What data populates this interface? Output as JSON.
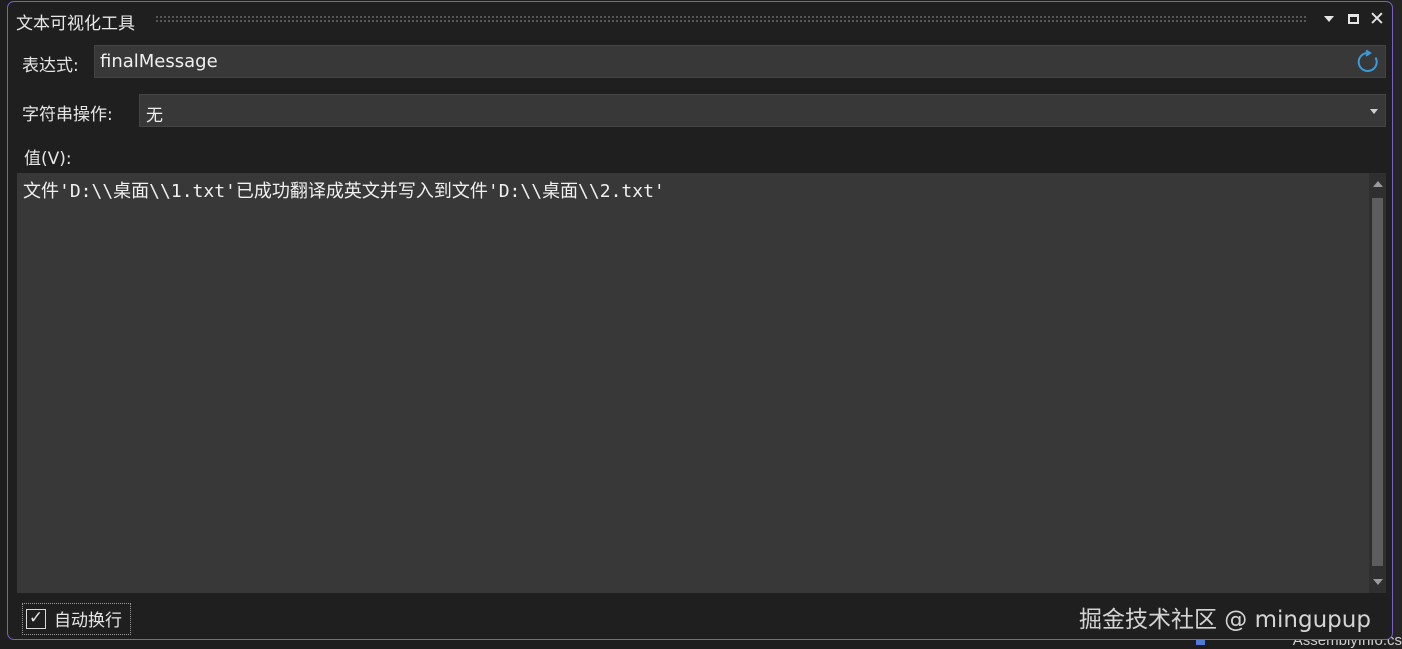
{
  "window": {
    "title": "文本可视化工具"
  },
  "expression": {
    "label": "表达式:",
    "value": "finalMessage"
  },
  "string_ops": {
    "label": "字符串操作:",
    "selected": "无"
  },
  "value_section": {
    "label": "值(V):",
    "text": "文件'D:\\\\桌面\\\\1.txt'已成功翻译成英文并写入到文件'D:\\\\桌面\\\\2.txt'"
  },
  "word_wrap": {
    "label": "自动换行",
    "checked_glyph": "✓"
  },
  "watermark": {
    "text": "掘金技术社区 @ mingupup"
  },
  "background": {
    "partial_text": "AssemblyInfo.cs"
  },
  "colors": {
    "accent_border": "#7c5fc6",
    "refresh_icon": "#3b9ad9"
  }
}
